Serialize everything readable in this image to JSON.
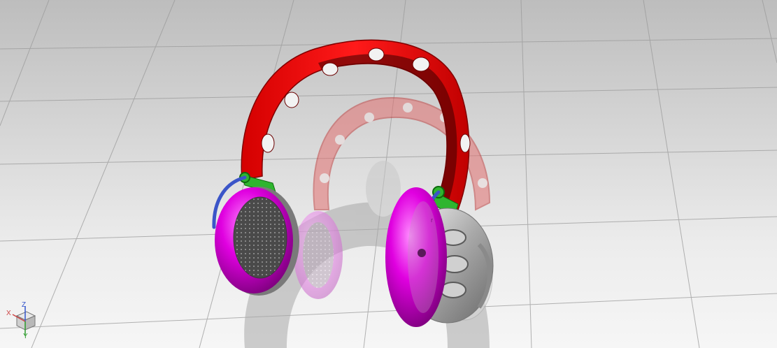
{
  "viewport": {
    "background_top": "#bdbdbd",
    "background_bottom": "#f6f6f6",
    "grid_color": "#9a9a9a"
  },
  "model": {
    "headband_color": "#e00000",
    "earcup_ring_color": "#e000e0",
    "hinge_color": "#2fb52f",
    "cable_color": "#3b55c8",
    "shell_color": "#c0c0c0",
    "mesh_color": "#505050"
  },
  "triad": {
    "x_label": "X",
    "y_label": "Y",
    "z_label": "Z",
    "icon": "view-orientation-cube-icon"
  }
}
